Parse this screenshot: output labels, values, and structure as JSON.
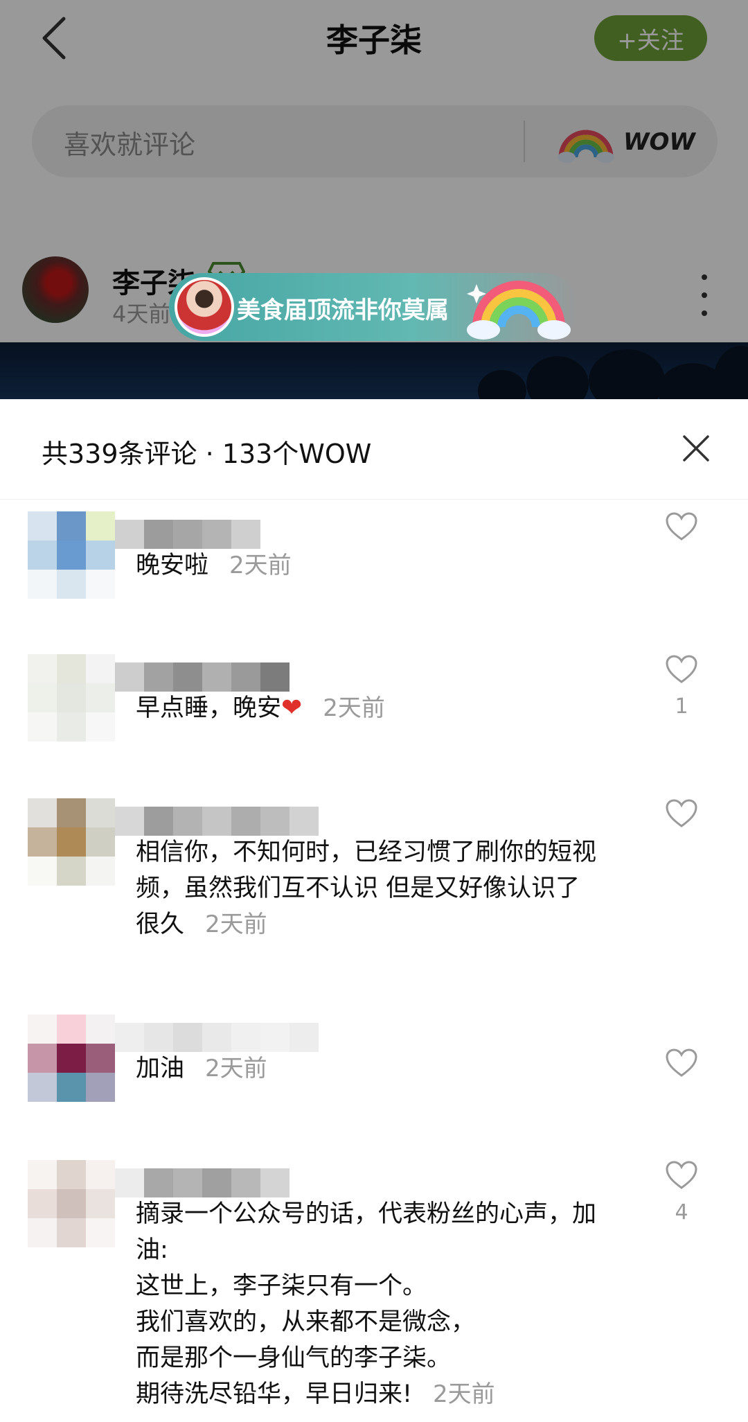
{
  "header": {
    "title": "李子柒",
    "follow_label": "+关注"
  },
  "comment_bar": {
    "placeholder": "喜欢就评论",
    "wow_label": "WOW"
  },
  "post": {
    "author": "李子柒",
    "time": "4天前"
  },
  "promo_banner": {
    "text": "美食届顶流非你莫属"
  },
  "sheet": {
    "count_text": "共339条评论 · 133个WOW"
  },
  "comments": [
    {
      "text": "晚安啦",
      "time": "2天前",
      "likes": ""
    },
    {
      "text": "早点睡，晚安",
      "emoji": "❤",
      "time": "2天前",
      "likes": "1"
    },
    {
      "text": "相信你，不知何时，已经习惯了刷你的短视\n频，虽然我们互不认识 但是又好像认识了\n很久",
      "time": "2天前",
      "likes": ""
    },
    {
      "text": "加油",
      "time": "2天前",
      "likes": ""
    },
    {
      "text": "摘录一个公众号的话，代表粉丝的心声，加\n油:\n这世上，李子柒只有一个。\n我们喜欢的，从来都不是微念，\n而是那个一身仙气的李子柒。\n期待洗尽铅华，早日归来!",
      "time": "2天前",
      "likes": "4"
    }
  ],
  "colors": {
    "follow_button": "#6f9f3a",
    "banner": "#46a6a4",
    "heart": "#e0302b"
  }
}
